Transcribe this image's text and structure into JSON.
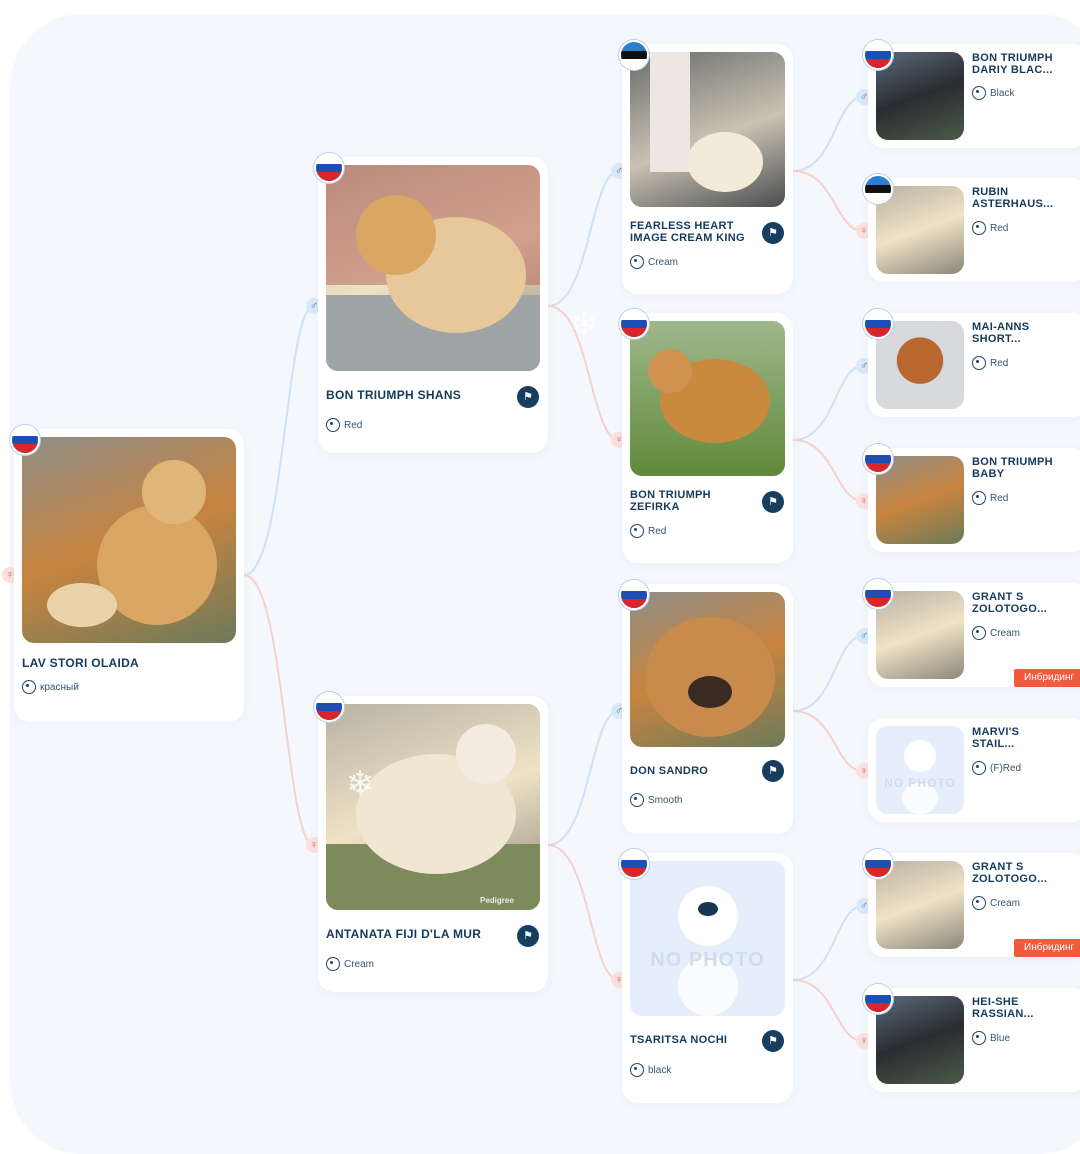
{
  "badge_label": "Инбридинг",
  "flag_russia": [
    "#ffffff",
    "#1c4fb5",
    "#d8262c"
  ],
  "flag_estonia": [
    "#2a7fd1",
    "#111111",
    "#ffffff"
  ],
  "male_symbol": "♂",
  "female_symbol": "♀",
  "snowflake": "❄",
  "no_photo_text": "NO PHOTO",
  "watermark": "Pedigree",
  "subject": {
    "name": "LAV STORI OLAIDA",
    "color": "красный"
  },
  "parents": {
    "sire": {
      "name": "BON TRIUMPH SHANS",
      "color": "Red"
    },
    "dam": {
      "name": "ANTANATA FIJI D'LA MUR",
      "color": "Cream"
    }
  },
  "grandparents": {
    "sire_sire": {
      "name": "FEARLESS HEART IMAGE CREAM KING",
      "color": "Cream"
    },
    "sire_dam": {
      "name": "BON TRIUMPH ZEFIRKA",
      "color": "Red"
    },
    "dam_sire": {
      "name": "DON SANDRO",
      "color": "Smooth"
    },
    "dam_dam": {
      "name": "TSARITSA NOCHI",
      "color": "black"
    }
  },
  "great_grandparents": [
    {
      "name": "BON TRIUMPH DARIY BLAC...",
      "color": "Black"
    },
    {
      "name": "RUBIN ASTERHAUS...",
      "color": "Red"
    },
    {
      "name": "MAI-ANNS SHORT...",
      "color": "Red"
    },
    {
      "name": "BON TRIUMPH BABY",
      "color": "Red"
    },
    {
      "name": "GRANT S ZOLOTOGO...",
      "color": "Cream"
    },
    {
      "name": "MARVI'S STAIL...",
      "color": "(F)Red"
    },
    {
      "name": "GRANT S ZOLOTOGO...",
      "color": "Cream"
    },
    {
      "name": "HEI-SHE RASSIAN...",
      "color": "Blue"
    }
  ]
}
